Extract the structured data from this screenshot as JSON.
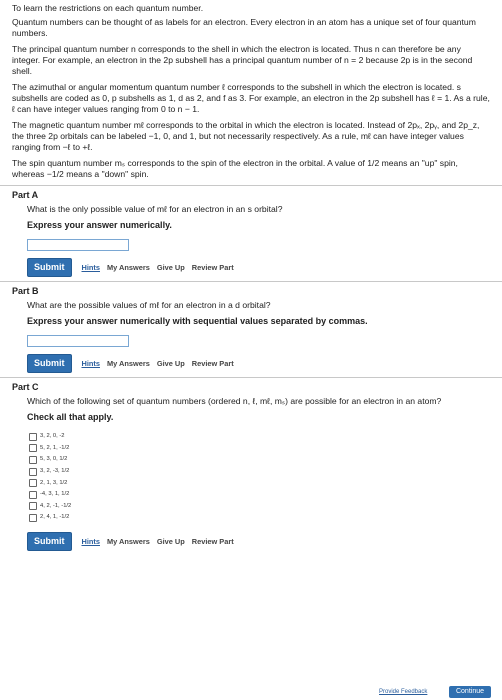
{
  "intro": {
    "objective": "To learn the restrictions on each quantum number.",
    "p1": "Quantum numbers can be thought of as labels for an electron. Every electron in an atom has a unique set of four quantum numbers.",
    "p2": "The principal quantum number n corresponds to the shell in which the electron is located. Thus n can therefore be any integer. For example, an electron in the 2p subshell has a principal quantum number of n = 2 because 2p is in the second shell.",
    "p3": "The azimuthal or angular momentum quantum number ℓ corresponds to the subshell in which the electron is located. s subshells are coded as 0, p subshells as 1, d as 2, and f as 3. For example, an electron in the 2p subshell has ℓ = 1. As a rule, ℓ can have integer values ranging from 0 to n − 1.",
    "p4": "The magnetic quantum number mℓ corresponds to the orbital in which the electron is located. Instead of 2pₓ, 2pᵧ, and 2p_z, the three 2p orbitals can be labeled −1, 0, and 1, but not necessarily respectively. As a rule, mℓ can have integer values ranging from −ℓ to +ℓ.",
    "p5": "The spin quantum number mₛ corresponds to the spin of the electron in the orbital. A value of 1/2 means an \"up\" spin, whereas −1/2 means a \"down\" spin."
  },
  "toolbar": {
    "submit": "Submit",
    "hints": "Hints",
    "my_answers": "My Answers",
    "give_up": "Give Up",
    "review_part": "Review Part"
  },
  "partA": {
    "title": "Part A",
    "question": "What is the only possible value of mℓ for an electron in an s orbital?",
    "instruction": "Express your answer numerically.",
    "value": ""
  },
  "partB": {
    "title": "Part B",
    "question": "What are the possible values of mℓ for an electron in a d orbital?",
    "instruction": "Express your answer numerically with sequential values separated by commas.",
    "value": ""
  },
  "partC": {
    "title": "Part C",
    "question": "Which of the following set of quantum numbers (ordered n, ℓ, mℓ, mₛ) are possible for an electron in an atom?",
    "instruction": "Check all that apply.",
    "options": [
      "3, 2, 0, -2",
      "5, 2, 1, -1/2",
      "5, 3, 0, 1/2",
      "3, 2, -3, 1/2",
      "2, 1, 3, 1/2",
      "-4, 3, 1, 1/2",
      "4, 2, -1, -1/2",
      "2, 4, 1, -1/2"
    ]
  },
  "footer": {
    "feedback": "Provide Feedback",
    "continue": "Continue"
  }
}
